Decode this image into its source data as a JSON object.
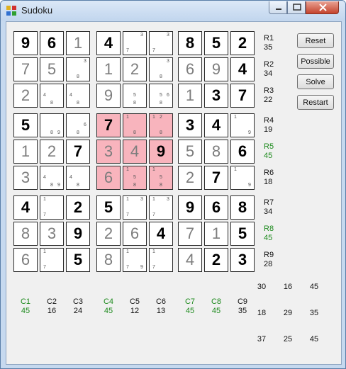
{
  "window": {
    "title": "Sudoku",
    "controls": {
      "minimize": "minimize",
      "maximize": "maximize",
      "close": "close"
    }
  },
  "buttons": [
    "Reset",
    "Possible",
    "Solve",
    "Restart"
  ],
  "grid": {
    "cells": [
      [
        {
          "v": "9",
          "t": "g"
        },
        {
          "v": "6",
          "t": "g"
        },
        {
          "v": "1",
          "t": "s"
        },
        {
          "v": "4",
          "t": "g"
        },
        {
          "v": "",
          "c": [
            "3",
            "7"
          ]
        },
        {
          "v": "",
          "c": [
            "3",
            "7"
          ]
        },
        {
          "v": "8",
          "t": "g"
        },
        {
          "v": "5",
          "t": "g"
        },
        {
          "v": "2",
          "t": "g"
        }
      ],
      [
        {
          "v": "7",
          "t": "s"
        },
        {
          "v": "5",
          "t": "s"
        },
        {
          "v": "",
          "c": [
            "3",
            "8"
          ]
        },
        {
          "v": "1",
          "t": "s"
        },
        {
          "v": "2",
          "t": "s"
        },
        {
          "v": "",
          "c": [
            "3",
            "8"
          ]
        },
        {
          "v": "6",
          "t": "s"
        },
        {
          "v": "9",
          "t": "s"
        },
        {
          "v": "4",
          "t": "g"
        }
      ],
      [
        {
          "v": "2",
          "t": "s"
        },
        {
          "v": "",
          "c": [
            "4",
            "8"
          ]
        },
        {
          "v": "",
          "c": [
            "4",
            "8"
          ]
        },
        {
          "v": "9",
          "t": "s"
        },
        {
          "v": "",
          "c": [
            "5",
            "8"
          ]
        },
        {
          "v": "",
          "c": [
            "5",
            "6",
            "8"
          ]
        },
        {
          "v": "1",
          "t": "s"
        },
        {
          "v": "3",
          "t": "g"
        },
        {
          "v": "7",
          "t": "g"
        }
      ],
      [
        {
          "v": "5",
          "t": "g"
        },
        {
          "v": "",
          "c": [
            "8",
            "9"
          ]
        },
        {
          "v": "",
          "c": [
            "6",
            "8"
          ]
        },
        {
          "v": "7",
          "t": "g",
          "hl": true
        },
        {
          "v": "",
          "c": [
            "1",
            "8"
          ],
          "hl": true
        },
        {
          "v": "",
          "c": [
            "1",
            "2",
            "8"
          ],
          "hl": true
        },
        {
          "v": "3",
          "t": "g"
        },
        {
          "v": "4",
          "t": "g"
        },
        {
          "v": "",
          "c": [
            "1",
            "9"
          ]
        }
      ],
      [
        {
          "v": "1",
          "t": "s"
        },
        {
          "v": "2",
          "t": "s"
        },
        {
          "v": "7",
          "t": "g"
        },
        {
          "v": "3",
          "t": "s",
          "hl": true
        },
        {
          "v": "4",
          "t": "s",
          "hl": true
        },
        {
          "v": "9",
          "t": "g",
          "hl": true
        },
        {
          "v": "5",
          "t": "s"
        },
        {
          "v": "8",
          "t": "s"
        },
        {
          "v": "6",
          "t": "g"
        }
      ],
      [
        {
          "v": "3",
          "t": "s"
        },
        {
          "v": "",
          "c": [
            "4",
            "8",
            "9"
          ]
        },
        {
          "v": "",
          "c": [
            "4",
            "8"
          ]
        },
        {
          "v": "6",
          "t": "s",
          "hl": true
        },
        {
          "v": "",
          "c": [
            "1",
            "5",
            "8"
          ],
          "hl": true
        },
        {
          "v": "",
          "c": [
            "1",
            "5",
            "8"
          ],
          "hl": true
        },
        {
          "v": "2",
          "t": "s"
        },
        {
          "v": "7",
          "t": "g"
        },
        {
          "v": "",
          "c": [
            "1",
            "9"
          ]
        }
      ],
      [
        {
          "v": "4",
          "t": "g"
        },
        {
          "v": "",
          "c": [
            "1",
            "7"
          ]
        },
        {
          "v": "2",
          "t": "g"
        },
        {
          "v": "5",
          "t": "g"
        },
        {
          "v": "",
          "c": [
            "1",
            "3",
            "7"
          ]
        },
        {
          "v": "",
          "c": [
            "1",
            "3",
            "7"
          ]
        },
        {
          "v": "9",
          "t": "g"
        },
        {
          "v": "6",
          "t": "g"
        },
        {
          "v": "8",
          "t": "g"
        }
      ],
      [
        {
          "v": "8",
          "t": "s"
        },
        {
          "v": "3",
          "t": "s"
        },
        {
          "v": "9",
          "t": "g"
        },
        {
          "v": "2",
          "t": "s"
        },
        {
          "v": "6",
          "t": "s"
        },
        {
          "v": "4",
          "t": "g"
        },
        {
          "v": "7",
          "t": "s"
        },
        {
          "v": "1",
          "t": "s"
        },
        {
          "v": "5",
          "t": "g"
        }
      ],
      [
        {
          "v": "6",
          "t": "s"
        },
        {
          "v": "",
          "c": [
            "1",
            "7"
          ]
        },
        {
          "v": "5",
          "t": "g"
        },
        {
          "v": "8",
          "t": "s"
        },
        {
          "v": "",
          "c": [
            "1",
            "7",
            "9"
          ]
        },
        {
          "v": "",
          "c": [
            "1",
            "7"
          ]
        },
        {
          "v": "4",
          "t": "s"
        },
        {
          "v": "2",
          "t": "g"
        },
        {
          "v": "3",
          "t": "g"
        }
      ]
    ]
  },
  "row_labels": [
    {
      "name": "R1",
      "sum": "35",
      "ok": false
    },
    {
      "name": "R2",
      "sum": "34",
      "ok": false
    },
    {
      "name": "R3",
      "sum": "22",
      "ok": false
    },
    {
      "name": "R4",
      "sum": "19",
      "ok": false
    },
    {
      "name": "R5",
      "sum": "45",
      "ok": true
    },
    {
      "name": "R6",
      "sum": "18",
      "ok": false
    },
    {
      "name": "R7",
      "sum": "34",
      "ok": false
    },
    {
      "name": "R8",
      "sum": "45",
      "ok": true
    },
    {
      "name": "R9",
      "sum": "28",
      "ok": false
    }
  ],
  "col_labels": [
    {
      "name": "C1",
      "sum": "45",
      "ok": true
    },
    {
      "name": "C2",
      "sum": "16",
      "ok": false
    },
    {
      "name": "C3",
      "sum": "24",
      "ok": false
    },
    {
      "name": "C4",
      "sum": "45",
      "ok": true
    },
    {
      "name": "C5",
      "sum": "12",
      "ok": false
    },
    {
      "name": "C6",
      "sum": "13",
      "ok": false
    },
    {
      "name": "C7",
      "sum": "45",
      "ok": true
    },
    {
      "name": "C8",
      "sum": "45",
      "ok": true
    },
    {
      "name": "C9",
      "sum": "35",
      "ok": false
    }
  ],
  "box_sums": [
    [
      {
        "sum": "30",
        "ok": false
      },
      {
        "sum": "16",
        "ok": false
      },
      {
        "sum": "45",
        "ok": true
      }
    ],
    [
      {
        "sum": "18",
        "ok": false
      },
      {
        "sum": "29",
        "ok": false
      },
      {
        "sum": "35",
        "ok": false
      }
    ],
    [
      {
        "sum": "37",
        "ok": false
      },
      {
        "sum": "25",
        "ok": false
      },
      {
        "sum": "45",
        "ok": true
      }
    ]
  ],
  "colors": {
    "highlight": "#f8b4bd",
    "complete": "#1d8a1d",
    "given": "#000000",
    "solved": "#7d7d7d"
  }
}
